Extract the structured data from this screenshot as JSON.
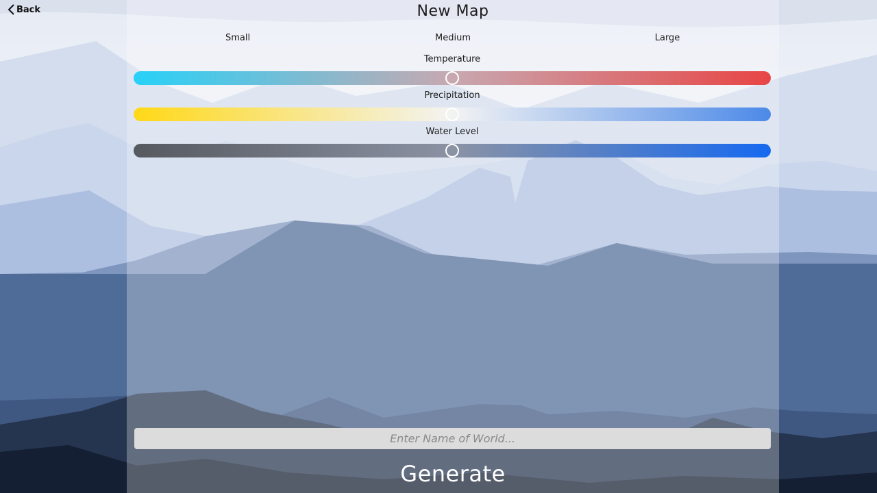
{
  "header": {
    "back_label": "Back",
    "title": "New Map"
  },
  "map_size": {
    "options": [
      "Small",
      "Medium",
      "Large"
    ]
  },
  "sliders": [
    {
      "label": "Temperature",
      "value": 0.5,
      "gradient": [
        "#27d1f8",
        "#c8a8b0",
        "#e84545"
      ]
    },
    {
      "label": "Precipitation",
      "value": 0.5,
      "gradient": [
        "#ffd817",
        "#f3f3f3",
        "#4c89e8"
      ]
    },
    {
      "label": "Water Level",
      "value": 0.5,
      "gradient": [
        "#56595f",
        "#8b93a4",
        "#1669f0"
      ]
    }
  ],
  "world_name": {
    "value": "",
    "placeholder": "Enter Name of World..."
  },
  "generate_label": "Generate"
}
